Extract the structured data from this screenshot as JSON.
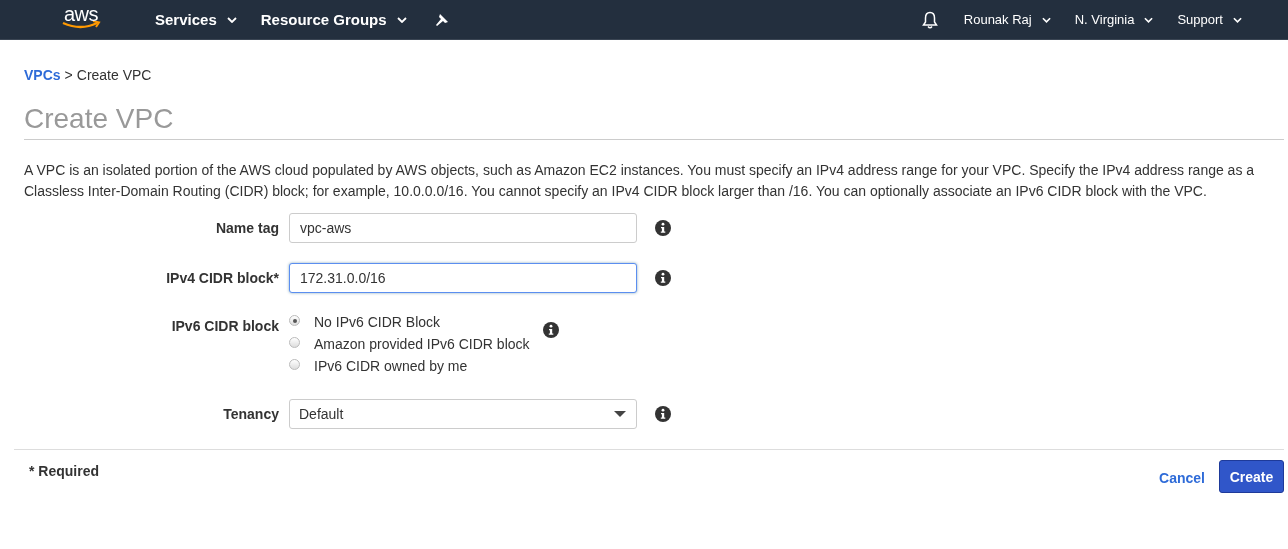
{
  "navbar": {
    "logo": "aws",
    "menus": [
      {
        "label": "Services"
      },
      {
        "label": "Resource Groups"
      }
    ],
    "right_menus": [
      {
        "label": "Rounak Raj"
      },
      {
        "label": "N. Virginia"
      },
      {
        "label": "Support"
      }
    ]
  },
  "breadcrumb": {
    "link": "VPCs",
    "separator": ">",
    "current": "Create VPC"
  },
  "title": "Create VPC",
  "description": "A VPC is an isolated portion of the AWS cloud populated by AWS objects, such as Amazon EC2 instances. You must specify an IPv4 address range for your VPC. Specify the IPv4 address range as a Classless Inter-Domain Routing (CIDR) block; for example, 10.0.0.0/16. You cannot specify an IPv4 CIDR block larger than /16. You can optionally associate an IPv6 CIDR block with the VPC.",
  "fields": [
    {
      "kind": "text",
      "label": "Name tag",
      "value": "vpc-aws",
      "focused": false
    },
    {
      "kind": "text",
      "label": "IPv4 CIDR block*",
      "value": "172.31.0.0/16",
      "focused": true
    },
    {
      "kind": "radio",
      "label": "IPv6 CIDR block",
      "options": [
        {
          "label": "No IPv6 CIDR Block",
          "selected": true
        },
        {
          "label": "Amazon provided IPv6 CIDR block",
          "selected": false
        },
        {
          "label": "IPv6 CIDR owned by me",
          "selected": false
        }
      ]
    },
    {
      "kind": "select",
      "label": "Tenancy",
      "value": "Default"
    }
  ],
  "footer": {
    "note": "* Required",
    "cancel": "Cancel",
    "create": "Create"
  }
}
